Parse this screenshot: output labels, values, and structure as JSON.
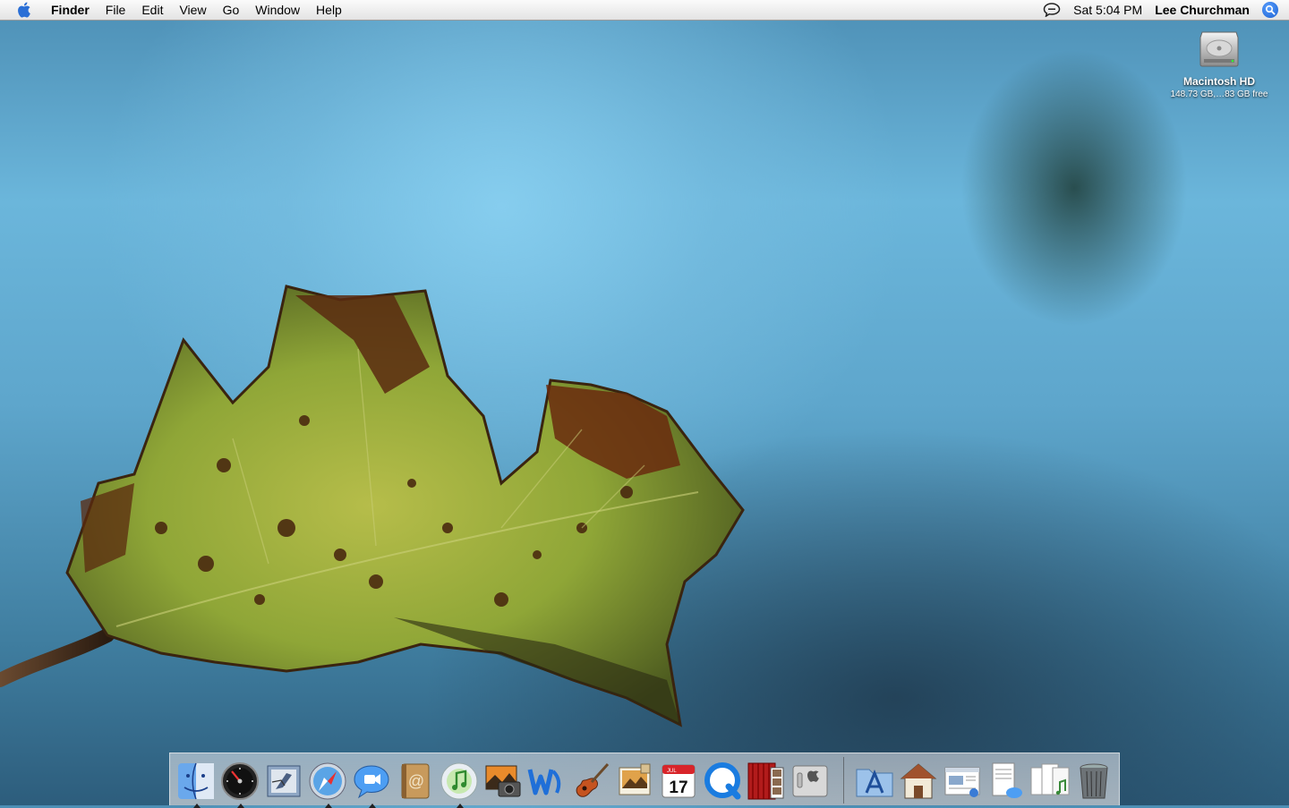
{
  "menubar": {
    "items": [
      "Finder",
      "File",
      "Edit",
      "View",
      "Go",
      "Window",
      "Help"
    ],
    "clock": "Sat 5:04 PM",
    "user": "Lee Churchman",
    "icons": [
      "apple-icon",
      "ichat-status-icon",
      "spotlight-icon"
    ]
  },
  "desktop": {
    "disk": {
      "name": "Macintosh HD",
      "info": "148.73 GB,…83 GB free"
    }
  },
  "dock": {
    "apps": [
      {
        "name": "Finder",
        "icon": "finder-icon",
        "running": true
      },
      {
        "name": "Dashboard",
        "icon": "dashboard-icon",
        "running": true
      },
      {
        "name": "Mail",
        "icon": "mail-icon",
        "running": false
      },
      {
        "name": "Safari",
        "icon": "safari-icon",
        "running": true
      },
      {
        "name": "iChat",
        "icon": "ichat-icon",
        "running": true
      },
      {
        "name": "Address Book",
        "icon": "address-book-icon",
        "running": false
      },
      {
        "name": "iTunes",
        "icon": "itunes-icon",
        "running": true
      },
      {
        "name": "iPhoto",
        "icon": "iphoto-icon",
        "running": false
      },
      {
        "name": "iWeb",
        "icon": "iweb-icon",
        "running": false
      },
      {
        "name": "GarageBand",
        "icon": "garageband-icon",
        "running": false
      },
      {
        "name": "Preview",
        "icon": "preview-icon",
        "running": false
      },
      {
        "name": "iCal",
        "icon": "ical-icon",
        "running": false,
        "month": "JUL",
        "day": "17"
      },
      {
        "name": "QuickTime Player",
        "icon": "quicktime-icon",
        "running": false
      },
      {
        "name": "Photo Booth",
        "icon": "photo-booth-icon",
        "running": false
      },
      {
        "name": "System Preferences",
        "icon": "system-preferences-icon",
        "running": false
      }
    ],
    "docs": [
      {
        "name": "Applications",
        "icon": "applications-folder-icon"
      },
      {
        "name": "Home",
        "icon": "home-icon"
      },
      {
        "name": "Document",
        "icon": "document-icon"
      },
      {
        "name": "Chat Document",
        "icon": "chat-document-icon"
      },
      {
        "name": "Music Documents",
        "icon": "music-documents-icon"
      },
      {
        "name": "Trash",
        "icon": "trash-icon"
      }
    ]
  },
  "colors": {
    "sky": "#6bb6db",
    "leaf_green": "#8fa637",
    "leaf_brown": "#5a2a10",
    "spotlight": "#1a5fd0"
  }
}
